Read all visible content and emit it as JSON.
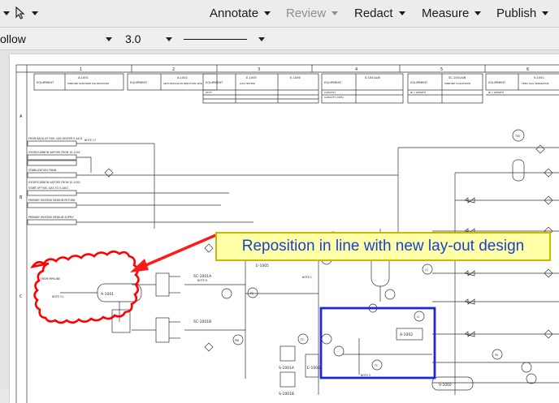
{
  "toolbar": {
    "annotate": "Annotate",
    "review": "Review",
    "redact": "Redact",
    "measure": "Measure",
    "publish": "Publish"
  },
  "properties": {
    "style_value": "ollow",
    "width_value": "3.0"
  },
  "callout": {
    "text": "Reposition in line with new lay-out design"
  },
  "drawing": {
    "columns": [
      "1",
      "2",
      "3",
      "4",
      "5",
      "6"
    ],
    "rows": [
      "A",
      "B",
      "C"
    ],
    "header": {
      "equipment": "EQUIPMENT",
      "tags": [
        "A-1001",
        "A-1002",
        "E-1005",
        "E-1006",
        "S-1001A/B",
        "SC-1001A/B",
        "V-1001"
      ],
      "descriptions": [
        "PIPELINE ONSHORE PIG RECEIVER",
        "ANTI-EMULSION INJECTION SKID",
        "GAS HEATER",
        "INLET",
        "INLET",
        "PIPELINE COALESCER",
        "FEED GAS SEPARATOR"
      ],
      "duty": "DUTY",
      "capacity": "CAPACITY",
      "capacity_design": "CAPACITY (DES)",
      "length": "ID x LENGTH"
    },
    "left_lines": [
      "FROM BACK-UP FUEL GAS HEATER E-4401",
      "HYDROCARBON VAPORS FROM 1E-1001",
      "STABILIZATION TRAIN",
      "HYDROCARBON VAPORS FROM 1E-1002",
      "START-UP FUEL GAS TO E-4401",
      "PRIMARY HEATING MEDIUM RETURN",
      "PRIMARY HEATING MEDIUM SUPPLY"
    ],
    "equipment_labels": [
      "A-1001",
      "SC-1001A",
      "SC-1001B",
      "E-1005",
      "V-1001",
      "A-1002",
      "V-1002",
      "S-1001A",
      "S-1001B",
      "E-1006"
    ],
    "notes": [
      "NOTE 1",
      "NOTE 4",
      "NOTE 5",
      "NOTE 6",
      "NOTE 17",
      "NOTE 5,1"
    ],
    "instrument_tags": [
      "PI",
      "TI",
      "LC",
      "PC",
      "FC",
      "TC",
      "LI",
      "PG",
      "PDI",
      "TSV"
    ],
    "pipeline_from": "FROM PIPELINE"
  },
  "colors": {
    "cloud": "#ff0000",
    "arrow": "#ff1a1a",
    "box": "#1f28d6",
    "callout_fill": "#ffffa8",
    "callout_text": "#1b3fd6"
  }
}
